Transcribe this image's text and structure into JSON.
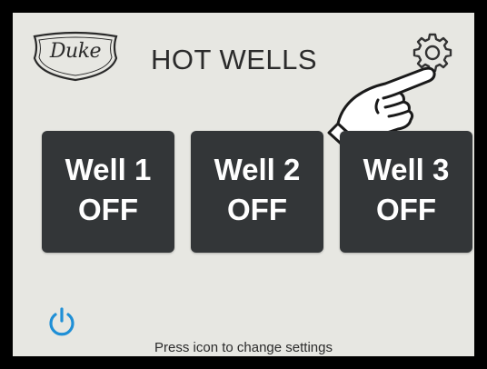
{
  "header": {
    "logo_text": "Duke",
    "title": "HOT WELLS"
  },
  "wells": [
    {
      "name": "Well 1",
      "status": "OFF"
    },
    {
      "name": "Well 2",
      "status": "OFF"
    },
    {
      "name": "Well 3",
      "status": "OFF"
    }
  ],
  "footer": {
    "hint": "Press icon to change settings"
  },
  "icons": {
    "settings": "gear-icon",
    "power": "power-icon",
    "pointer": "pointing-hand-icon"
  },
  "colors": {
    "screen_background": "#e7e7e2",
    "well_background": "#333638",
    "well_text": "#ffffff",
    "power_icon": "#1f8fd6",
    "text": "#2b2b2b"
  }
}
